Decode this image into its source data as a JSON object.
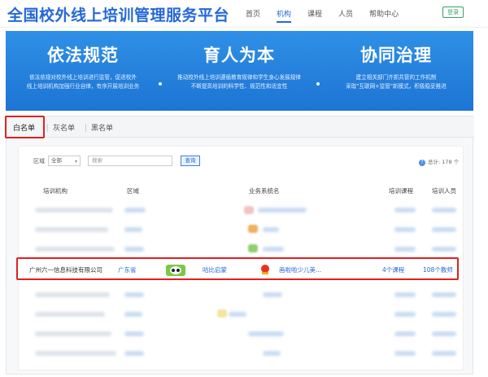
{
  "header": {
    "site_title": "全国校外线上培训管理服务平台",
    "nav": [
      "首页",
      "机构",
      "课程",
      "人员",
      "帮助中心"
    ],
    "active_nav": "机构",
    "login_label": "登录"
  },
  "banner": [
    {
      "heading": "依法规范",
      "lines": [
        "依法依规对校外线上培训进行监管，促进校外",
        "线上培训机构加强行业自律，有序开展培训业务"
      ]
    },
    {
      "heading": "育人为本",
      "lines": [
        "推动校外线上培训遵循教育规律和学生身心发展规律",
        "不断提高培训的科学性、规范性和适宜性"
      ]
    },
    {
      "heading": "协同治理",
      "lines": [
        "建立相关部门齐抓共管的工作机制",
        "采取\"互联网+监管\"新模式，积极稳妥推进"
      ]
    }
  ],
  "tabs": [
    "白名单",
    "灰名单",
    "黑名单"
  ],
  "filters": {
    "region_label": "区域",
    "region_value": "全部",
    "search_placeholder": "搜索",
    "query_button": "查询",
    "total": "总计: 178 个"
  },
  "table": {
    "columns": [
      "培训机构",
      "区域",
      "业务系统名",
      "培训课程",
      "培训人员"
    ],
    "highlighted_row": {
      "org": "广州六一信息科技有限公司",
      "region": "广东省",
      "system_1": "咕比启蒙",
      "system_2": "画啦啦少儿美...",
      "courses": "4个课程",
      "staff": "108个教师"
    }
  },
  "colors": {
    "brand_blue": "#2568d8",
    "highlight_red": "#e02020",
    "login_green": "#3a9f6a"
  }
}
